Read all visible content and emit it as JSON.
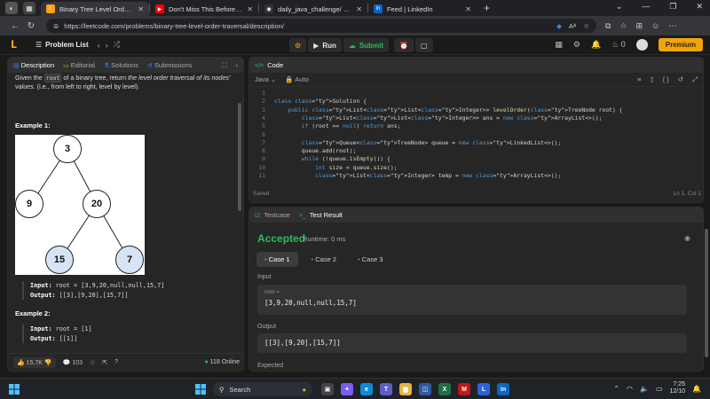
{
  "browser": {
    "tabs": [
      {
        "title": "Binary Tree Level Order Traversal",
        "fav": "L",
        "color": "#ffa116",
        "active": true
      },
      {
        "title": "Don't Miss This Before Your",
        "fav": "▶",
        "color": "#ff0000",
        "active": false
      },
      {
        "title": "daily_java_challenge/ at main · Hi",
        "fav": "◉",
        "color": "#333333",
        "active": false
      },
      {
        "title": "Feed | LinkedIn",
        "fav": "in",
        "color": "#0a66c2",
        "active": false
      }
    ],
    "new_tab": "+",
    "url": "https://leetcode.com/problems/binary-tree-level-order-traversal/description/"
  },
  "header": {
    "problem_list": "Problem List",
    "run": "Run",
    "submit": "Submit",
    "streak": "0",
    "premium": "Premium"
  },
  "desc": {
    "tabs": [
      "Description",
      "Editorial",
      "Solutions",
      "Submissions"
    ],
    "intro_a": "Given the ",
    "intro_code": "root",
    "intro_b": " of a binary tree, return ",
    "intro_em": "the level order traversal of its nodes' values",
    "intro_c": ". (i.e., from left to right, level by level).",
    "example1": "Example 1:",
    "tree_nodes": [
      "3",
      "9",
      "20",
      "15",
      "7"
    ],
    "ex1_input_label": "Input:",
    "ex1_input": "root = [3,9,20,null,null,15,7]",
    "ex1_output_label": "Output:",
    "ex1_output": "[[3],[9,20],[15,7]]",
    "example2": "Example 2:",
    "ex2_input_label": "Input:",
    "ex2_input": "root = [1]",
    "ex2_output_label": "Output:",
    "ex2_output": "[[1]]",
    "likes": "15.7K",
    "comments": "103",
    "online": "118 Online"
  },
  "code": {
    "title": "Code",
    "lang": "Java",
    "mode": "Auto",
    "saved": "Saved",
    "cursor": "Ln 1, Col 1",
    "lines": [
      {
        "n": "1",
        "t": ""
      },
      {
        "n": "2",
        "t": "class Solution {"
      },
      {
        "n": "3",
        "t": "    public List<List<Integer>> levelOrder(TreeNode root) {"
      },
      {
        "n": "4",
        "t": "        List<List<Integer>> ans = new ArrayList<>();"
      },
      {
        "n": "5",
        "t": "        if (root == null) return ans;"
      },
      {
        "n": "6",
        "t": ""
      },
      {
        "n": "7",
        "t": "        Queue<TreeNode> queue = new LinkedList<>();"
      },
      {
        "n": "8",
        "t": "        queue.add(root);"
      },
      {
        "n": "9",
        "t": "        while (!queue.isEmpty()) {"
      },
      {
        "n": "10",
        "t": "            int size = queue.size();"
      },
      {
        "n": "11",
        "t": "            List<Integer> temp = new ArrayList<>();"
      }
    ]
  },
  "test": {
    "tab_testcase": "Testcase",
    "tab_result": "Test Result",
    "status": "Accepted",
    "runtime": "Runtime: 0 ms",
    "cases": [
      "Case 1",
      "Case 2",
      "Case 3"
    ],
    "input_label": "Input",
    "root_label": "root =",
    "input_value": "[3,9,20,null,null,15,7]",
    "output_label": "Output",
    "output_value": "[[3],[9,20],[15,7]]",
    "expected_label": "Expected"
  },
  "taskbar": {
    "search": "Search",
    "time": "7:25",
    "date": "12/10",
    "apps": [
      {
        "name": "edge",
        "label": "e",
        "color": "#0c8bd8"
      },
      {
        "name": "explorer",
        "label": "▆",
        "color": "#e6b33c"
      },
      {
        "name": "store",
        "label": "◫",
        "color": "#2c5aa0"
      },
      {
        "name": "leetcode",
        "label": "L",
        "color": "#2b63d9"
      },
      {
        "name": "linkedin",
        "label": "in",
        "color": "#0a66c2"
      }
    ]
  }
}
